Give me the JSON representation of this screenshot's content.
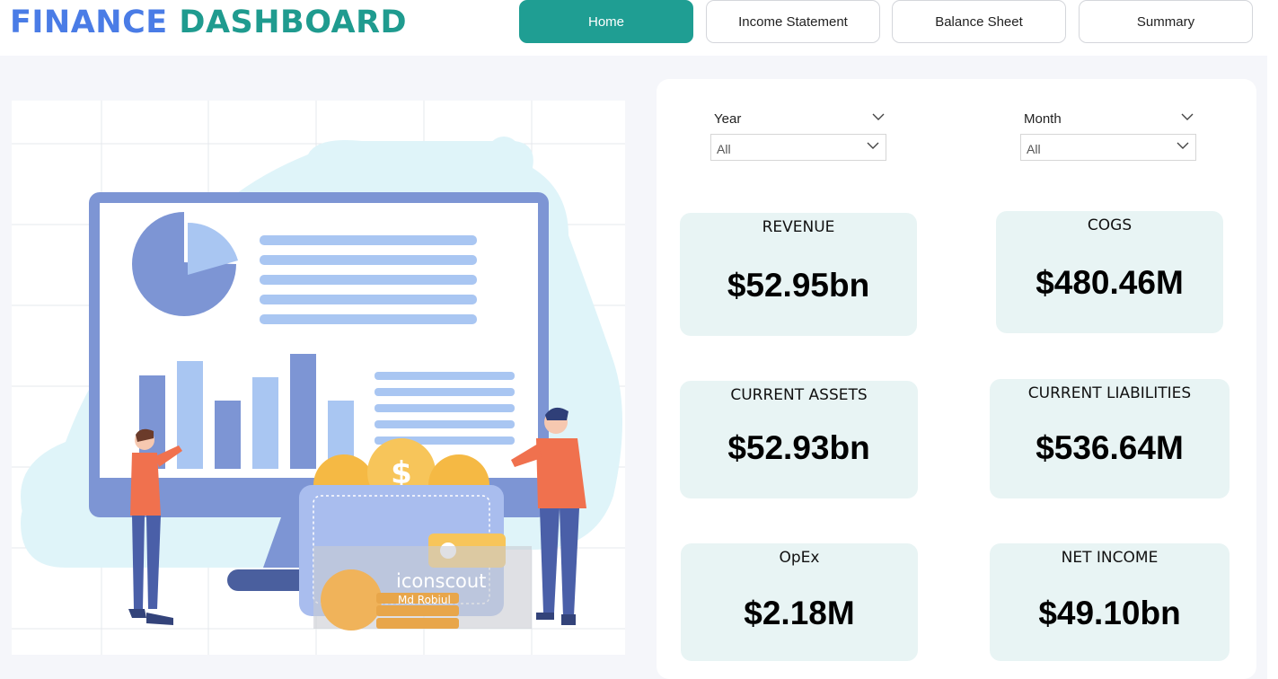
{
  "header": {
    "title_part1": "FINANCE",
    "title_part2": "DASHBOARD",
    "title_colors": [
      "#4a7ce6",
      "#1f9b8f"
    ]
  },
  "nav": [
    {
      "label": "Home",
      "active": true
    },
    {
      "label": "Income Statement",
      "active": false
    },
    {
      "label": "Balance Sheet",
      "active": false
    },
    {
      "label": "Summary",
      "active": false
    }
  ],
  "accent_color": "#1f9e93",
  "illustration": {
    "icon": "finance-analytics-illustration",
    "watermark_brand": "iconscout",
    "watermark_author": "Md Robiul"
  },
  "filters": {
    "year": {
      "label": "Year",
      "value": "All"
    },
    "month": {
      "label": "Month",
      "value": "All"
    }
  },
  "kpis": [
    {
      "label": "REVENUE",
      "value": "$52.95bn"
    },
    {
      "label": "COGS",
      "value": "$480.46M"
    },
    {
      "label": "CURRENT ASSETS",
      "value": "$52.93bn"
    },
    {
      "label": "CURRENT LIABILITIES",
      "value": "$536.64M"
    },
    {
      "label": "OpEx",
      "value": "$2.18M"
    },
    {
      "label": "NET INCOME",
      "value": "$49.10bn"
    }
  ]
}
